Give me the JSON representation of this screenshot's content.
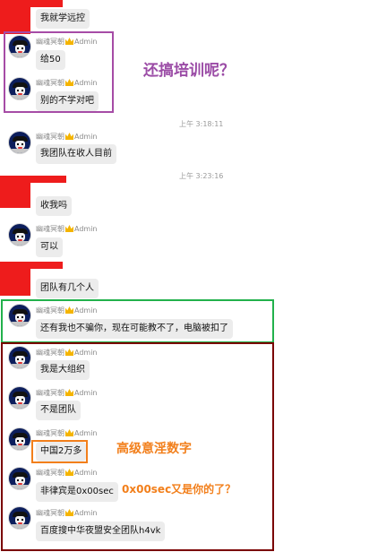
{
  "colors": {
    "redacted": "#ee1c1c",
    "purple_box": "#a64ca6",
    "green_box": "#22b14c",
    "darkred_box": "#7a0000",
    "orange": "#f27f1b",
    "bubble": "#ececec"
  },
  "sender_name": "幽魂冥朝",
  "sender_badge": "Admin",
  "timestamps": [
    "上午 3:18:11",
    "上午 3:23:16"
  ],
  "messages": {
    "m1": "我就学远控",
    "m2": "给50",
    "m3": "别的不学对吧",
    "m4": "我团队在收人目前",
    "m5": "收我吗",
    "m6": "可以",
    "m7": "团队有几个人",
    "m8": "还有我也不骗你，现在可能教不了，电脑被扣了",
    "m9": "我是大组织",
    "m10": "不是团队",
    "m11": "中国2万多",
    "m12": "非律宾是0x00sec",
    "m13": "百度搜中华夜盟安全团队h4vk"
  },
  "annotations": {
    "purple": "还搞培训呢？",
    "orange1": "高级意淫数字",
    "orange2": "0x00sec又是你的了？"
  }
}
